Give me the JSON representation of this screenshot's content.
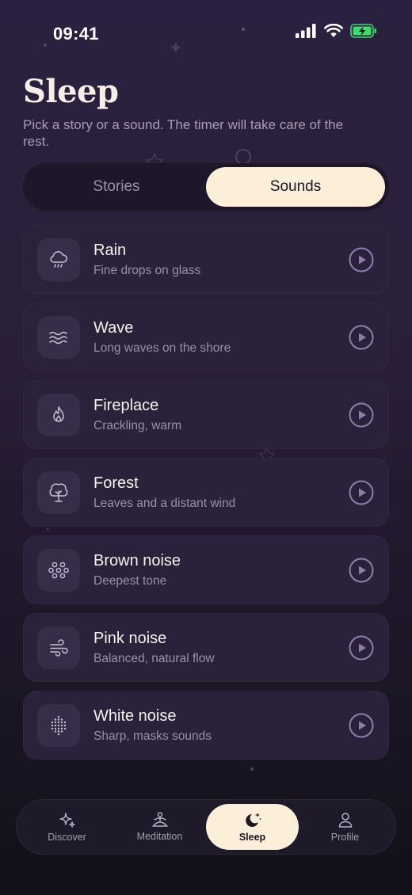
{
  "status_bar": {
    "time": "09:41",
    "icons": [
      "cellular-signal-icon",
      "wifi-icon",
      "battery-charging-icon"
    ]
  },
  "header": {
    "title": "Sleep",
    "subtitle": "Pick a story or a sound. The timer will take care of the rest."
  },
  "segmented": {
    "options": [
      "Stories",
      "Sounds"
    ],
    "selected": "Sounds"
  },
  "sounds": [
    {
      "title": "Rain",
      "subtitle": "Fine drops on glass",
      "icon": "rain-cloud-icon"
    },
    {
      "title": "Wave",
      "subtitle": "Long waves on the shore",
      "icon": "waves-icon"
    },
    {
      "title": "Fireplace",
      "subtitle": "Crackling, warm",
      "icon": "flame-icon"
    },
    {
      "title": "Forest",
      "subtitle": "Leaves and a distant wind",
      "icon": "tree-icon"
    },
    {
      "title": "Brown noise",
      "subtitle": "Deepest tone",
      "icon": "dots-cluster-icon"
    },
    {
      "title": "Pink noise",
      "subtitle": "Balanced, natural flow",
      "icon": "wind-icon"
    },
    {
      "title": "White noise",
      "subtitle": "Sharp, masks sounds",
      "icon": "dots-grid-icon"
    }
  ],
  "tabbar": {
    "items": [
      {
        "label": "Discover",
        "icon": "sparkle-icon"
      },
      {
        "label": "Meditation",
        "icon": "meditation-icon"
      },
      {
        "label": "Sleep",
        "icon": "moon-stars-icon"
      },
      {
        "label": "Profile",
        "icon": "person-icon"
      }
    ],
    "selected": "Sleep"
  },
  "colors": {
    "accent": "#fcefd9",
    "card": "#2a223b",
    "icon_tile": "#362d48",
    "play_ring": "#8f7fa8",
    "battery_green": "#3ddc6a"
  }
}
